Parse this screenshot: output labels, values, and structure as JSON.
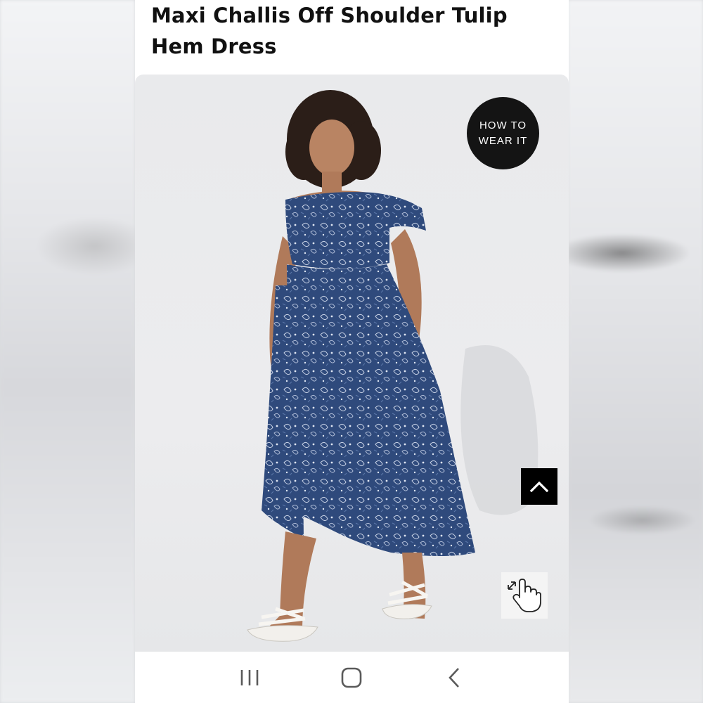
{
  "product": {
    "title": "Maxi Challis Off Shoulder Tulip Hem Dress"
  },
  "image_overlay": {
    "how_to_line1": "HOW TO",
    "how_to_line2": "WEAR IT",
    "back_to_top_icon": "chevron-up-icon",
    "zoom_hint_icon": "pinch-zoom-hand-icon"
  },
  "nav_bar": {
    "recents_icon": "recent-apps-icon",
    "home_icon": "home-icon",
    "back_icon": "back-icon"
  },
  "colors": {
    "dress_navy": "#2f4a7c",
    "badge_black": "#141414",
    "background": "#ffffff"
  }
}
